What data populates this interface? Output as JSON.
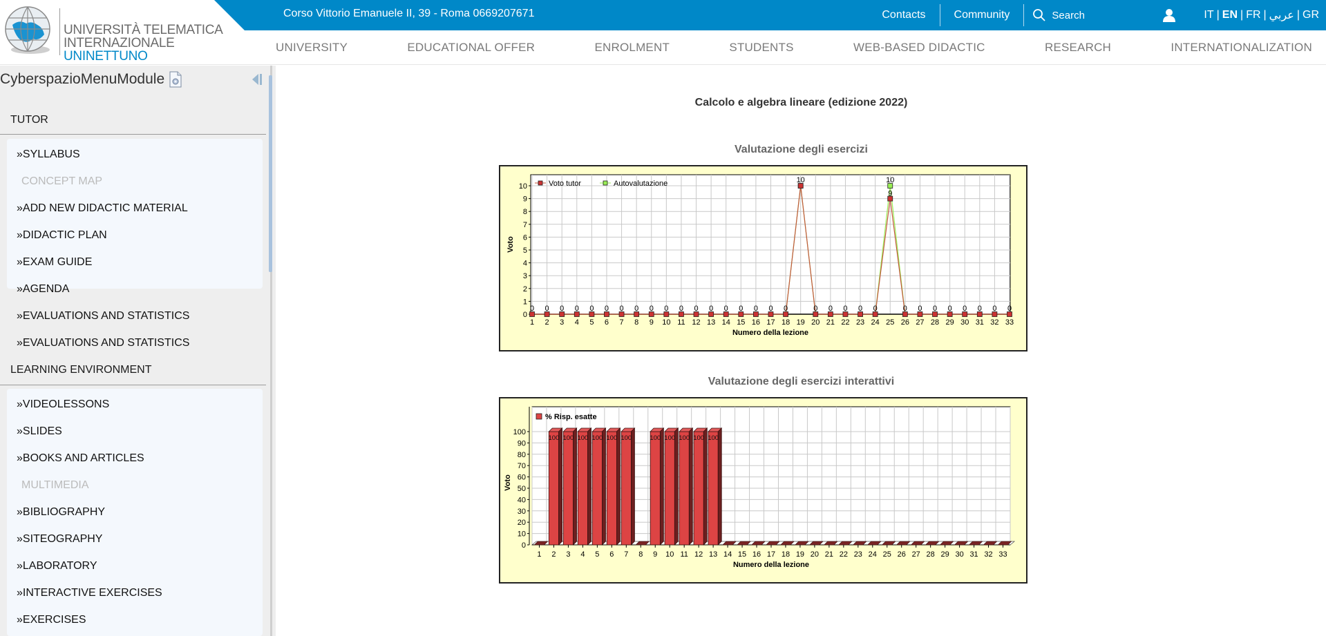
{
  "header": {
    "logo": {
      "line1": "UNIVERSITÀ TELEMATICA",
      "line2_main": "INTERNAZIONALE ",
      "line2_accent": "UNINETTUNO"
    },
    "address": "Corso Vittorio Emanuele II, 39 - Roma 0669207671",
    "top_links": {
      "contacts": "Contacts",
      "community": "Community",
      "search": "Search"
    },
    "languages": [
      {
        "code": "IT",
        "active": false
      },
      {
        "code": "EN",
        "active": true
      },
      {
        "code": "FR",
        "active": false
      },
      {
        "code": "عربي",
        "active": false
      },
      {
        "code": "GR",
        "active": false
      }
    ],
    "nav": [
      "UNIVERSITY",
      "EDUCATIONAL OFFER",
      "ENROLMENT",
      "STUDENTS",
      "WEB-BASED DIDACTIC",
      "RESEARCH",
      "INTERNATIONALIZATION"
    ],
    "brand_color": "#0088c8"
  },
  "sidebar": {
    "title": "CyberspazioMenuModule",
    "sections": [
      {
        "heading": "TUTOR",
        "items": [
          {
            "label": "»SYLLABUS",
            "enabled": true
          },
          {
            "label": "CONCEPT MAP",
            "enabled": false
          },
          {
            "label": "»ADD NEW DIDACTIC MATERIAL",
            "enabled": true
          },
          {
            "label": "»DIDACTIC PLAN",
            "enabled": true
          },
          {
            "label": "»EXAM GUIDE",
            "enabled": true
          },
          {
            "label": "»AGENDA",
            "enabled": true
          },
          {
            "label": "»EVALUATIONS AND STATISTICS",
            "enabled": true
          },
          {
            "label": "»EVALUATIONS AND STATISTICS",
            "enabled": true
          }
        ]
      },
      {
        "heading": "LEARNING ENVIRONMENT",
        "items": [
          {
            "label": "»VIDEOLESSONS",
            "enabled": true
          },
          {
            "label": "»SLIDES",
            "enabled": true
          },
          {
            "label": "»BOOKS AND ARTICLES",
            "enabled": true
          },
          {
            "label": "MULTIMEDIA",
            "enabled": false
          },
          {
            "label": "»BIBLIOGRAPHY",
            "enabled": true
          },
          {
            "label": "»SITEOGRAPHY",
            "enabled": true
          },
          {
            "label": "»LABORATORY",
            "enabled": true
          },
          {
            "label": "»INTERACTIVE EXERCISES",
            "enabled": true
          },
          {
            "label": "»EXERCISES",
            "enabled": true
          }
        ]
      }
    ]
  },
  "main": {
    "page_title": "Calcolo e algebra lineare (edizione 2022)"
  },
  "chart_data": [
    {
      "type": "line",
      "title": "Valutazione degli esercizi",
      "xlabel": "Numero della lezione",
      "ylabel": "Voto",
      "x": [
        1,
        2,
        3,
        4,
        5,
        6,
        7,
        8,
        9,
        10,
        11,
        12,
        13,
        14,
        15,
        16,
        17,
        18,
        19,
        20,
        21,
        22,
        23,
        24,
        25,
        26,
        27,
        28,
        29,
        30,
        31,
        32,
        33
      ],
      "ylim": [
        0,
        10
      ],
      "yticks": [
        0,
        1,
        2,
        3,
        4,
        5,
        6,
        7,
        8,
        9,
        10
      ],
      "grid": true,
      "legend": "top-left",
      "series": [
        {
          "name": "Voto tutor",
          "color": "#cc3333",
          "values": [
            0,
            0,
            0,
            0,
            0,
            0,
            0,
            0,
            0,
            0,
            0,
            0,
            0,
            0,
            0,
            0,
            0,
            0,
            10,
            0,
            0,
            0,
            0,
            0,
            9,
            0,
            0,
            0,
            0,
            0,
            0,
            0,
            0
          ]
        },
        {
          "name": "Autovalutazione",
          "color": "#99ee55",
          "values": [
            null,
            null,
            null,
            null,
            null,
            null,
            null,
            null,
            null,
            null,
            null,
            null,
            null,
            null,
            null,
            null,
            null,
            null,
            10,
            null,
            null,
            null,
            null,
            null,
            10,
            null,
            null,
            null,
            null,
            null,
            null,
            null,
            null
          ]
        }
      ],
      "background": "#ffffcc"
    },
    {
      "type": "bar",
      "title": "Valutazione degli esercizi interattivi",
      "xlabel": "Numero della lezione",
      "ylabel": "Voto",
      "categories": [
        "1",
        "2",
        "3",
        "4",
        "5",
        "6",
        "7",
        "8",
        "9",
        "10",
        "11",
        "12",
        "13",
        "14",
        "15",
        "16",
        "17",
        "18",
        "19",
        "20",
        "21",
        "22",
        "23",
        "24",
        "25",
        "26",
        "27",
        "28",
        "29",
        "30",
        "31",
        "32",
        "33"
      ],
      "ylim": [
        0,
        100
      ],
      "yticks": [
        0,
        10,
        20,
        30,
        40,
        50,
        60,
        70,
        80,
        90,
        100
      ],
      "grid": true,
      "legend": "top-left",
      "series": [
        {
          "name": "% Risp. esatte",
          "color": "#dd4444",
          "values": [
            0,
            100,
            100,
            100,
            100,
            100,
            100,
            0,
            100,
            100,
            100,
            100,
            100,
            0,
            0,
            0,
            0,
            0,
            0,
            0,
            0,
            0,
            0,
            0,
            0,
            0,
            0,
            0,
            0,
            0,
            0,
            0,
            0
          ]
        }
      ],
      "background": "#ffffcc"
    }
  ]
}
